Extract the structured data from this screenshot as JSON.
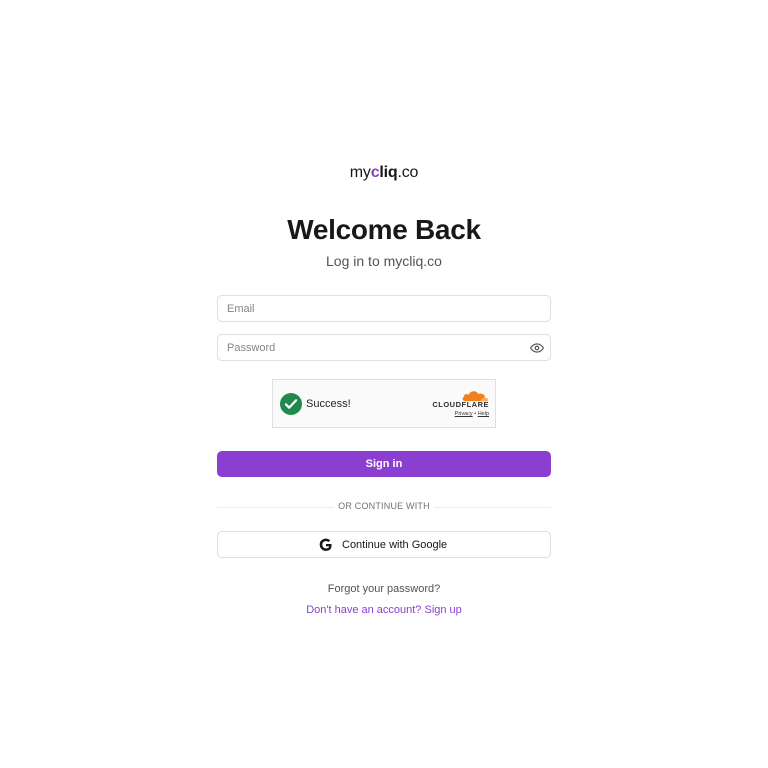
{
  "brand": {
    "logo_part1": "my",
    "logo_part2": "c",
    "logo_part3": "liq",
    "logo_part4": ".co",
    "accent_color": "#8b3fd0"
  },
  "header": {
    "title": "Welcome Back",
    "subtitle": "Log in to mycliq.co"
  },
  "form": {
    "email": {
      "value": "",
      "placeholder": "Email"
    },
    "password": {
      "value": "",
      "placeholder": "Password",
      "toggle_icon": "eye-icon"
    },
    "sign_in_label": "Sign in"
  },
  "captcha": {
    "status": "Success!",
    "status_icon": "check-circle-icon",
    "status_color": "#1f8a4c",
    "provider": "CLOUDFLARE",
    "provider_color": "#f38020",
    "privacy_label": "Privacy",
    "separator": "•",
    "help_label": "Help"
  },
  "divider": {
    "text": "OR CONTINUE WITH"
  },
  "google": {
    "label": "Continue with Google",
    "icon": "google-icon"
  },
  "links": {
    "forgot": "Forgot your password?",
    "signup": "Don't have an account? Sign up"
  }
}
